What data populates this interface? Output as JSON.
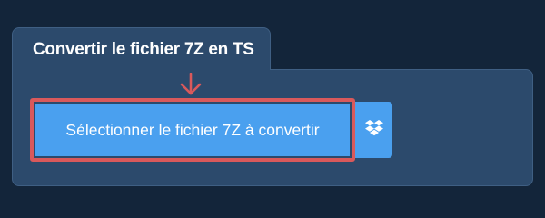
{
  "tab": {
    "title": "Convertir le fichier 7Z en TS"
  },
  "converter": {
    "select_button_label": "Sélectionner le fichier 7Z à convertir",
    "dropbox_icon": "dropbox-icon"
  },
  "colors": {
    "page_background": "#13253a",
    "panel_background": "#2c4a6c",
    "button_blue": "#4aa0ef",
    "highlight_red": "#d9595b"
  }
}
